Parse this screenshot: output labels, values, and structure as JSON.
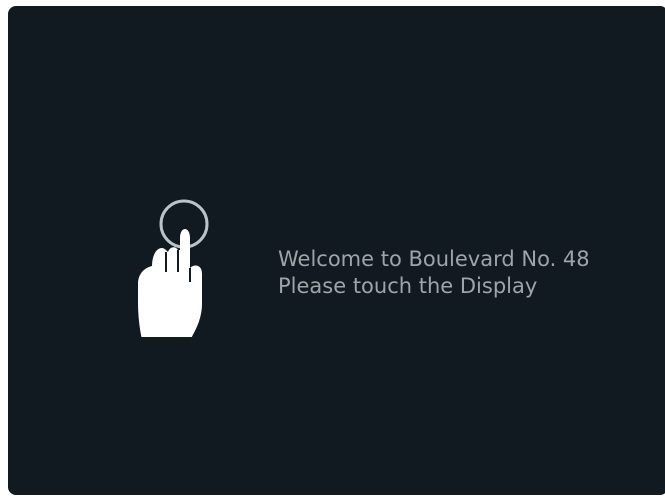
{
  "kiosk": {
    "welcome_line": "Welcome to Boulevard No. 48",
    "instruction_line": "Please touch the Display",
    "icon": "touch-hand-icon"
  },
  "colors": {
    "background": "#111a20",
    "text": "#9fa4a8",
    "hand": "#ffffff",
    "ring": "#b9c3c8"
  }
}
